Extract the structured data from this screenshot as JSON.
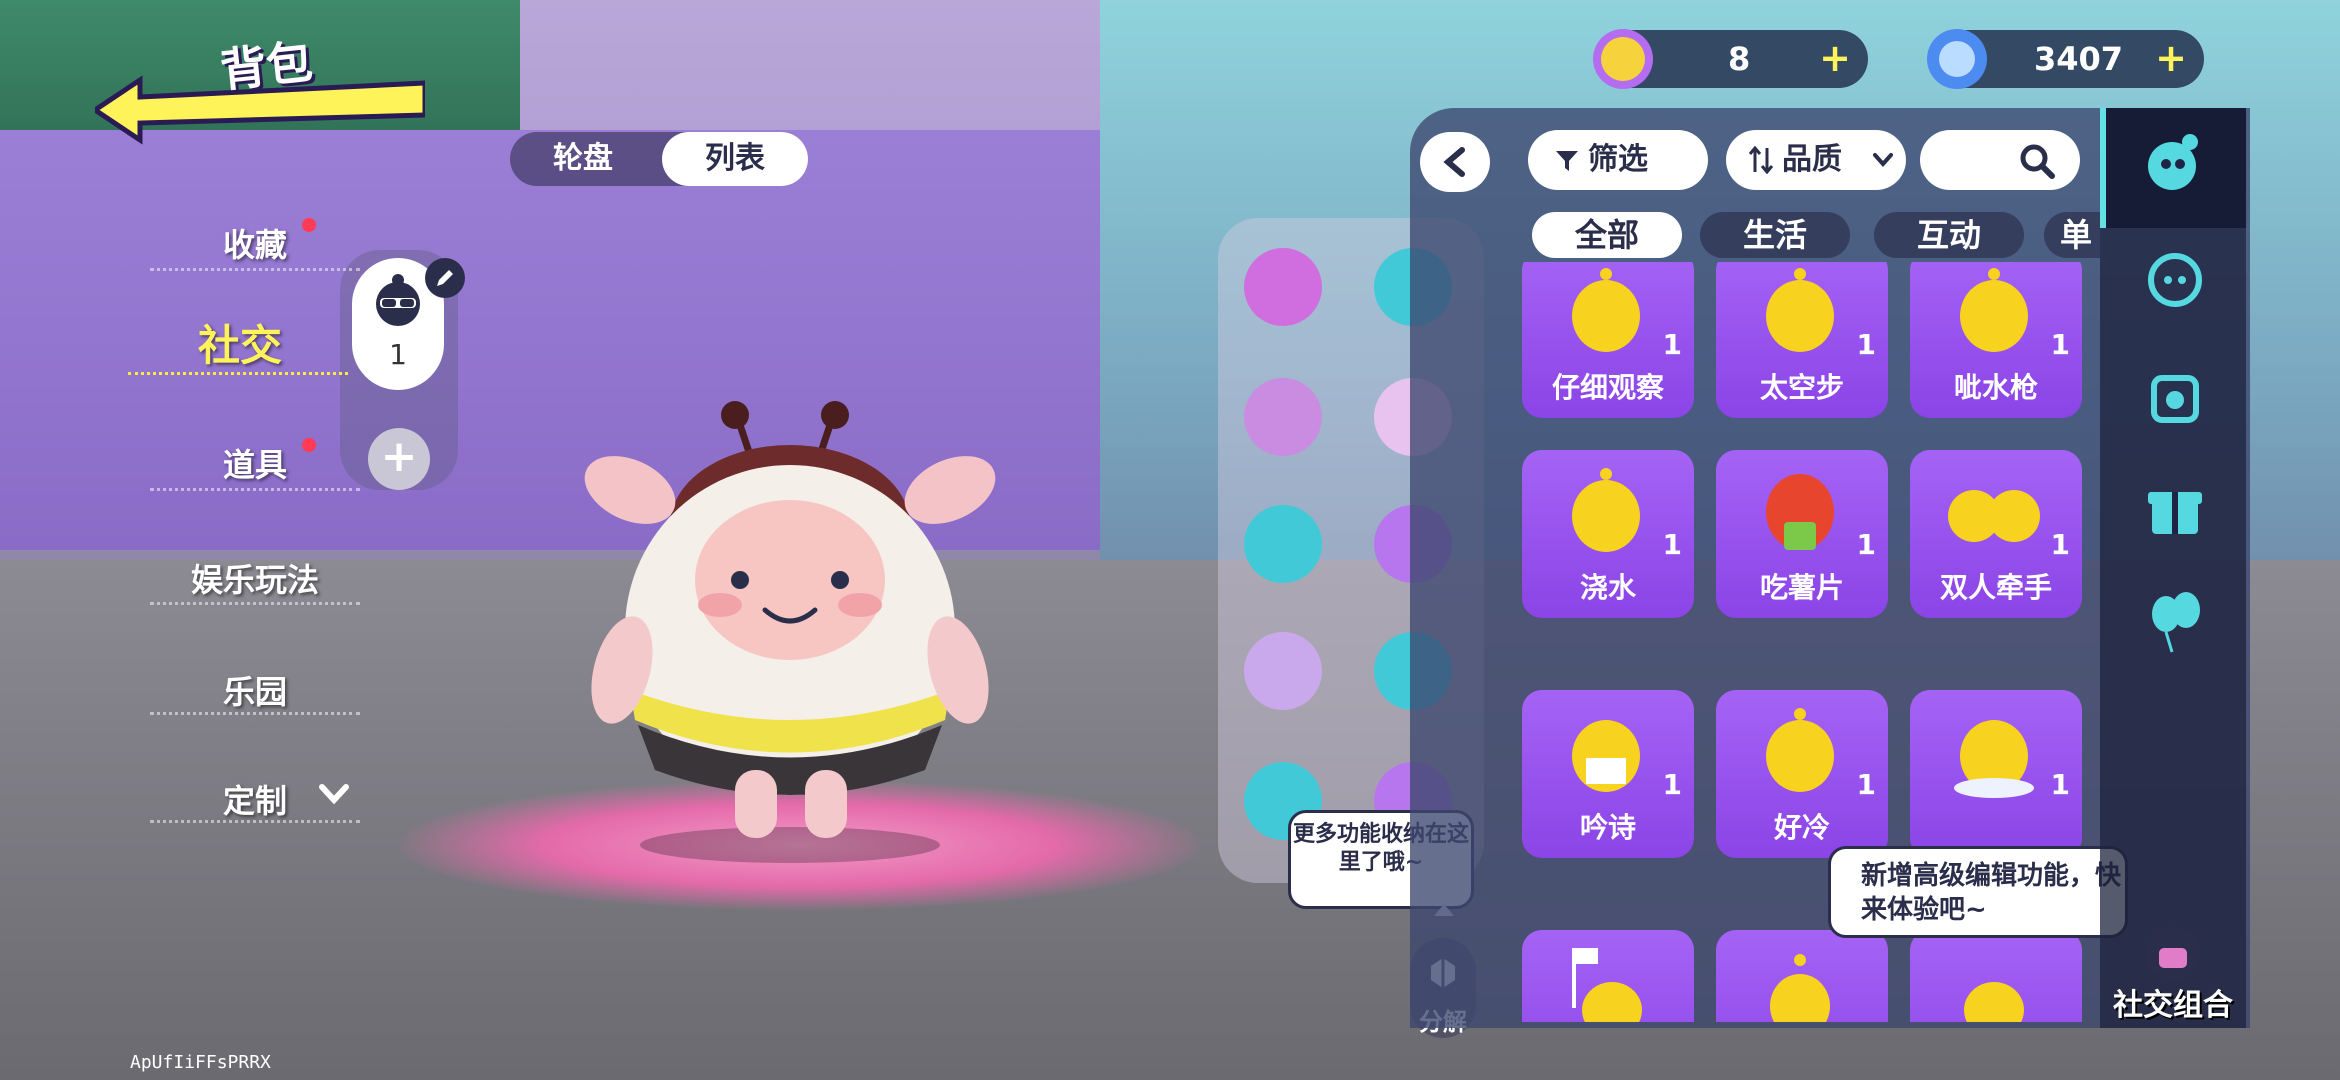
{
  "header": {
    "title": "背包"
  },
  "view_toggle": {
    "options": [
      "轮盘",
      "列表"
    ],
    "selected": "列表"
  },
  "left_menu": {
    "items": [
      {
        "label": "收藏",
        "badge": true
      },
      {
        "label": "社交",
        "active": true
      },
      {
        "label": "道具",
        "badge": true
      },
      {
        "label": "娱乐玩法"
      },
      {
        "label": "乐园"
      },
      {
        "label": "定制",
        "chevron": "chevron-down-icon"
      }
    ],
    "equipped_slot": {
      "count": "1",
      "icon": "cool-sunglasses-chick-icon"
    }
  },
  "currency": [
    {
      "icon": "gold-coin-icon",
      "value": "8"
    },
    {
      "icon": "blue-gem-icon",
      "value": "3407"
    }
  ],
  "toolbar": {
    "filter_label": "筛选",
    "sort_label": "品质",
    "search_placeholder": ""
  },
  "tabs": [
    "全部",
    "生活",
    "互动",
    "单人"
  ],
  "selected_tab": "全部",
  "emotes": [
    {
      "name": "仔细观察",
      "qty": "1"
    },
    {
      "name": "太空步",
      "qty": "1"
    },
    {
      "name": "呲水枪",
      "qty": "1"
    },
    {
      "name": "浇水",
      "qty": "1"
    },
    {
      "name": "吃薯片",
      "qty": "1"
    },
    {
      "name": "双人牵手",
      "qty": "1"
    },
    {
      "name": "吟诗",
      "qty": "1"
    },
    {
      "name": "好冷",
      "qty": "1"
    },
    {
      "name": "",
      "qty": "1"
    },
    {
      "name": "",
      "qty": ""
    },
    {
      "name": "",
      "qty": ""
    },
    {
      "name": "",
      "qty": ""
    }
  ],
  "tooltips": {
    "wheel_hint": "更多功能收纳在这里了哦~",
    "edit_hint": "新增高级编辑功能，快来体验吧~"
  },
  "decompose_label": "分解",
  "side_nav": {
    "combo_label": "社交组合"
  },
  "watermark": "ApUfIiFFsPRRX",
  "colors": {
    "accent_yellow": "#fff35a",
    "card_purple": "#9a55ee",
    "panel_dark": "#3c466e"
  }
}
